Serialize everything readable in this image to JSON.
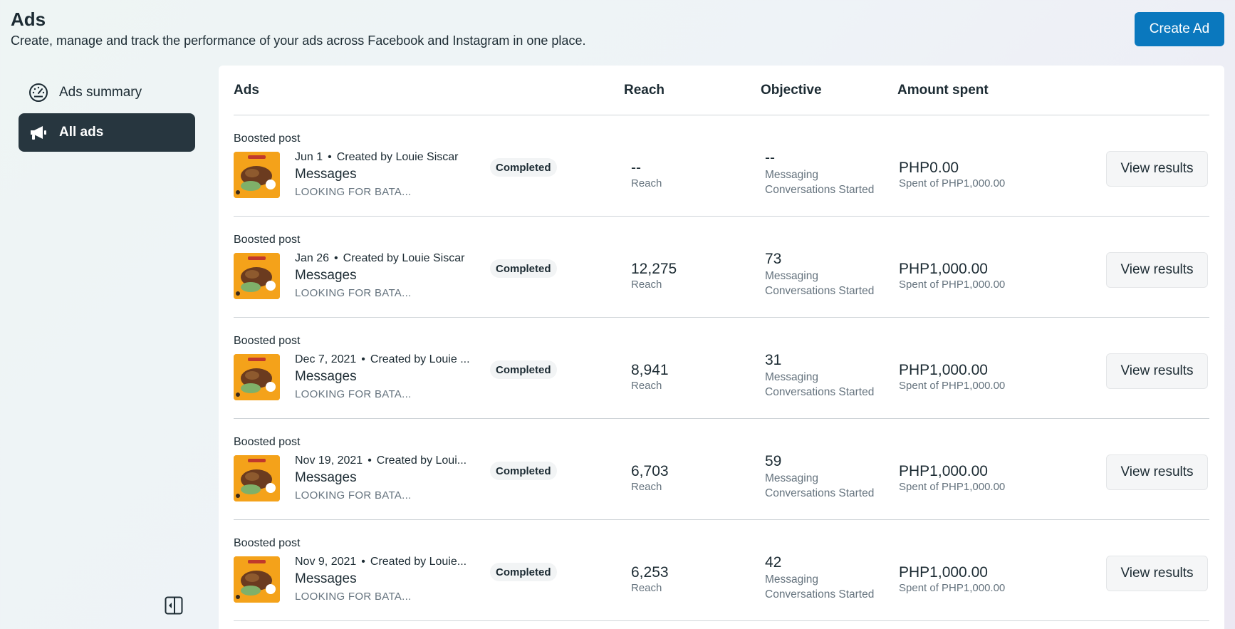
{
  "header": {
    "title": "Ads",
    "subtitle": "Create, manage and track the performance of your ads across Facebook and Instagram in one place.",
    "create_label": "Create Ad"
  },
  "sidebar": {
    "items": [
      {
        "label": "Ads summary",
        "icon": "gauge-icon"
      },
      {
        "label": "All ads",
        "icon": "megaphone-icon"
      }
    ]
  },
  "table": {
    "columns": [
      "Ads",
      "Reach",
      "Objective",
      "Amount spent"
    ],
    "rows": [
      {
        "type": "Boosted post",
        "date": "Jun 1",
        "creator": "Created by Louie Siscar",
        "title": "Messages",
        "caption": "LOOKING FOR BATA...",
        "status": "Completed",
        "reach": "--",
        "reach_label": "Reach",
        "objective_value": "--",
        "objective_label_1": "Messaging",
        "objective_label_2": "Conversations Started",
        "spent": "PHP0.00",
        "spent_label": "Spent of PHP1,000.00",
        "button": "View results"
      },
      {
        "type": "Boosted post",
        "date": "Jan 26",
        "creator": "Created by Louie Siscar",
        "title": "Messages",
        "caption": "LOOKING FOR BATA...",
        "status": "Completed",
        "reach": "12,275",
        "reach_label": "Reach",
        "objective_value": "73",
        "objective_label_1": "Messaging",
        "objective_label_2": "Conversations Started",
        "spent": "PHP1,000.00",
        "spent_label": "Spent of PHP1,000.00",
        "button": "View results"
      },
      {
        "type": "Boosted post",
        "date": "Dec 7, 2021",
        "creator": "Created by Louie ...",
        "title": "Messages",
        "caption": "LOOKING FOR BATA...",
        "status": "Completed",
        "reach": "8,941",
        "reach_label": "Reach",
        "objective_value": "31",
        "objective_label_1": "Messaging",
        "objective_label_2": "Conversations Started",
        "spent": "PHP1,000.00",
        "spent_label": "Spent of PHP1,000.00",
        "button": "View results"
      },
      {
        "type": "Boosted post",
        "date": "Nov 19, 2021",
        "creator": "Created by Loui...",
        "title": "Messages",
        "caption": "LOOKING FOR BATA...",
        "status": "Completed",
        "reach": "6,703",
        "reach_label": "Reach",
        "objective_value": "59",
        "objective_label_1": "Messaging",
        "objective_label_2": "Conversations Started",
        "spent": "PHP1,000.00",
        "spent_label": "Spent of PHP1,000.00",
        "button": "View results"
      },
      {
        "type": "Boosted post",
        "date": "Nov 9, 2021",
        "creator": "Created by Louie...",
        "title": "Messages",
        "caption": "LOOKING FOR BATA...",
        "status": "Completed",
        "reach": "6,253",
        "reach_label": "Reach",
        "objective_value": "42",
        "objective_label_1": "Messaging",
        "objective_label_2": "Conversations Started",
        "spent": "PHP1,000.00",
        "spent_label": "Spent of PHP1,000.00",
        "button": "View results"
      }
    ]
  },
  "colors": {
    "accent": "#0a78be",
    "nav_active": "#27363f",
    "thumb": "#f4a21a"
  }
}
